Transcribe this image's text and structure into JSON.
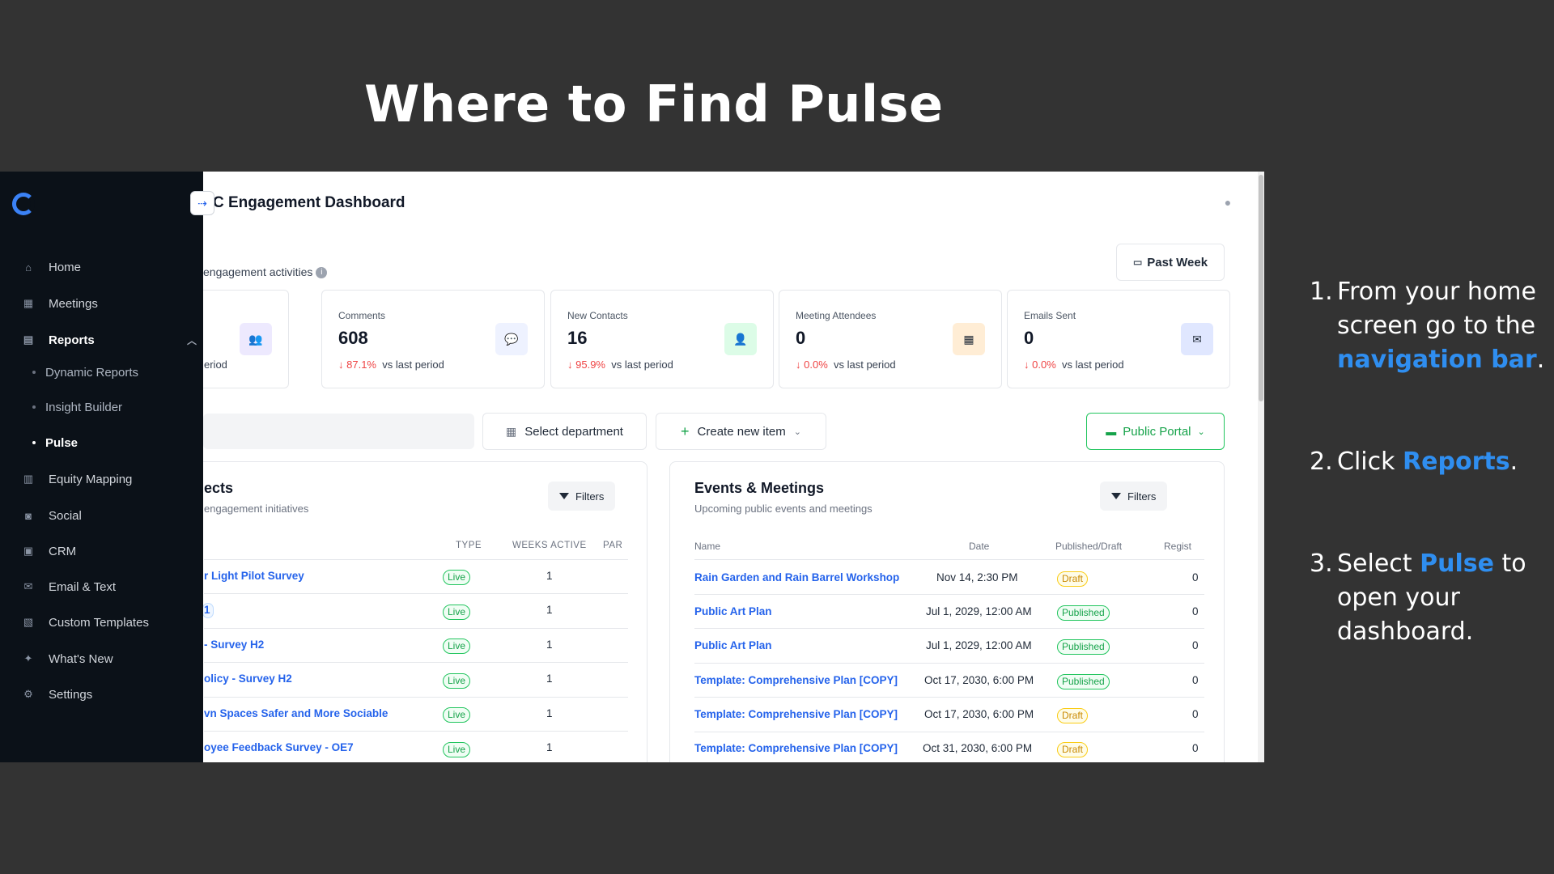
{
  "slide": {
    "title": "Where to Find Pulse",
    "steps": [
      {
        "num": "1.",
        "pre": "From your home screen go to the ",
        "highlight": "navigation bar",
        "post": "."
      },
      {
        "num": "2.",
        "pre": "Click ",
        "highlight": "Reports",
        "post": "."
      },
      {
        "num": "3.",
        "pre": "Select ",
        "highlight": "Pulse",
        "post": " to open your dashboard."
      }
    ],
    "accent_color": "#2f8ef0"
  },
  "sidebar": {
    "logo_icon": "app-logo-icon",
    "collapse_icon": "arrow-right-icon",
    "items": [
      {
        "label": "Home",
        "icon": "home-icon"
      },
      {
        "label": "Meetings",
        "icon": "calendar-icon"
      },
      {
        "label": "Reports",
        "icon": "report-icon"
      },
      {
        "label": "Equity Mapping",
        "icon": "map-icon"
      },
      {
        "label": "Social",
        "icon": "social-icon"
      },
      {
        "label": "CRM",
        "icon": "contacts-icon"
      },
      {
        "label": "Email & Text",
        "icon": "email-icon"
      },
      {
        "label": "Custom Templates",
        "icon": "template-icon"
      },
      {
        "label": "What's New",
        "icon": "sparkle-icon"
      },
      {
        "label": "Settings",
        "icon": "gear-icon"
      }
    ],
    "reports_subitems": [
      "Dynamic Reports",
      "Insight Builder",
      "Pulse"
    ]
  },
  "header": {
    "title": "C Engagement Dashboard",
    "date_range": "Past Week"
  },
  "overview": {
    "label": "engagement activities",
    "stats": [
      {
        "label": "",
        "value": "",
        "pct": "",
        "suffix": "eriod",
        "icon": "people-icon",
        "badge_color": "#ede9fe"
      },
      {
        "label": "Comments",
        "value": "608",
        "pct": "87.1%",
        "suffix": "vs last period",
        "icon": "comment-icon",
        "badge_color": "#eef2ff"
      },
      {
        "label": "New Contacts",
        "value": "16",
        "pct": "95.9%",
        "suffix": "vs last period",
        "icon": "add-user-icon",
        "badge_color": "#dcfce7"
      },
      {
        "label": "Meeting Attendees",
        "value": "0",
        "pct": "0.0%",
        "suffix": "vs last period",
        "icon": "calendar-check-icon",
        "badge_color": "#ffedd5"
      },
      {
        "label": "Emails Sent",
        "value": "0",
        "pct": "0.0%",
        "suffix": "vs last period",
        "icon": "envelope-icon",
        "badge_color": "#e0e7ff"
      }
    ]
  },
  "toolbar": {
    "select_department": "Select department",
    "create_new_item": "Create new item",
    "public_portal": "Public Portal"
  },
  "projects": {
    "title": "ects",
    "subtitle": "engagement initiatives",
    "filters": "Filters",
    "columns": [
      "TYPE",
      "WEEKS ACTIVE",
      "PAR"
    ],
    "rows": [
      {
        "name": "r Light Pilot Survey",
        "type": "Live",
        "weeks": "1"
      },
      {
        "name": "1",
        "type": "Live",
        "weeks": "1"
      },
      {
        "name": "- Survey H2",
        "type": "Live",
        "weeks": "1"
      },
      {
        "name": "olicy - Survey H2",
        "type": "Live",
        "weeks": "1"
      },
      {
        "name": "vn Spaces Safer and More Sociable",
        "type": "Live",
        "weeks": "1"
      },
      {
        "name": "oyee Feedback Survey - OE7",
        "type": "Live",
        "weeks": "1"
      }
    ]
  },
  "events": {
    "title": "Events & Meetings",
    "subtitle": "Upcoming public events and meetings",
    "filters": "Filters",
    "columns": [
      "Name",
      "Date",
      "Published/Draft",
      "Regist"
    ],
    "rows": [
      {
        "name": "Rain Garden and Rain Barrel Workshop",
        "date": "Nov 14, 2:30 PM",
        "status": "Draft",
        "reg": "0"
      },
      {
        "name": "Public Art Plan",
        "date": "Jul 1, 2029, 12:00 AM",
        "status": "Published",
        "reg": "0"
      },
      {
        "name": "Public Art Plan",
        "date": "Jul 1, 2029, 12:00 AM",
        "status": "Published",
        "reg": "0"
      },
      {
        "name": "Template: Comprehensive Plan [COPY]",
        "date": "Oct 17, 2030, 6:00 PM",
        "status": "Published",
        "reg": "0"
      },
      {
        "name": "Template: Comprehensive Plan [COPY]",
        "date": "Oct 17, 2030, 6:00 PM",
        "status": "Draft",
        "reg": "0"
      },
      {
        "name": "Template: Comprehensive Plan [COPY]",
        "date": "Oct 31, 2030, 6:00 PM",
        "status": "Draft",
        "reg": "0"
      }
    ]
  }
}
